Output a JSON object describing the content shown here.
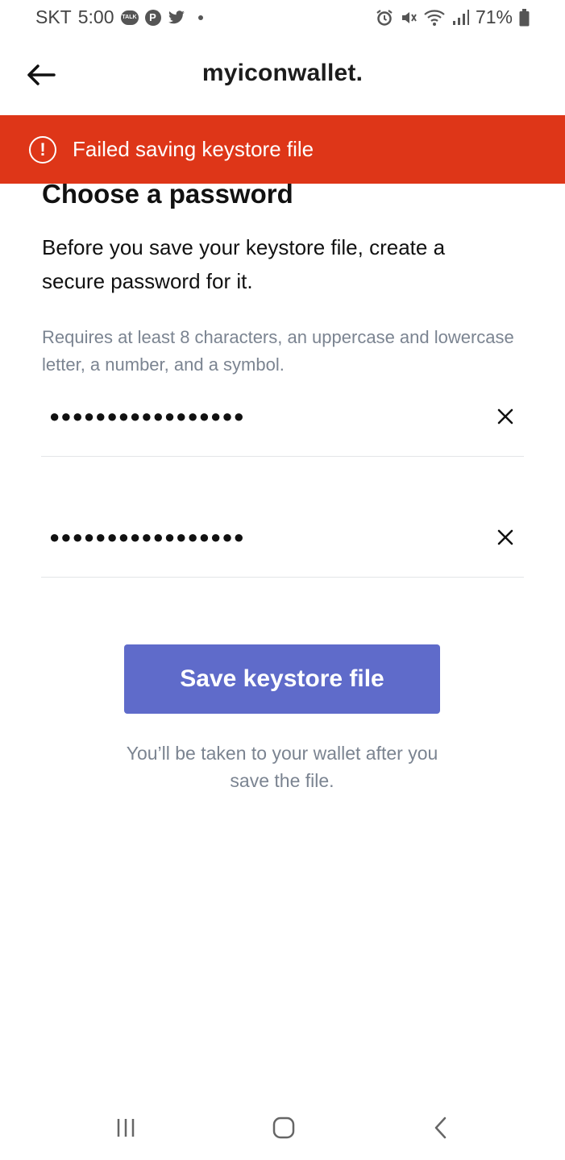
{
  "status_bar": {
    "carrier": "SKT",
    "time": "5:00",
    "talk_badge": "TALK",
    "pinterest_glyph": "P",
    "battery": "71%",
    "left_icons": [
      "kakaotalk-icon",
      "pinterest-icon",
      "twitter-icon",
      "dot-icon"
    ],
    "right_icons": [
      "alarm-icon",
      "mute-icon",
      "wifi-icon",
      "signal-icon",
      "battery-icon"
    ]
  },
  "header": {
    "back_icon": "arrow-left-icon",
    "logo": "myiconwallet."
  },
  "error_banner": {
    "icon": "exclamation-circle-icon",
    "icon_glyph": "!",
    "message": "Failed saving keystore file",
    "background": "#de3618"
  },
  "content": {
    "title": "Choose a password",
    "subtitle": "Before you save your keystore file, create a secure password for it.",
    "hint": "Requires at least 8 characters, an uppercase and lowercase letter, a number, and a symbol.",
    "password": {
      "masked_value": "●●●●●●●●●●●●●●●●●",
      "clear_icon": "close-icon"
    },
    "confirm_password": {
      "masked_value": "●●●●●●●●●●●●●●●●●",
      "clear_icon": "close-icon"
    },
    "save_button_label": "Save keystore file",
    "note": "You’ll be taken to your wallet after you save the file."
  },
  "colors": {
    "accent": "#5f6bca",
    "error": "#de3618",
    "muted_text": "#7b8491"
  },
  "nav_bar": {
    "icons": [
      "recent-apps-icon",
      "home-icon",
      "back-nav-icon"
    ]
  }
}
